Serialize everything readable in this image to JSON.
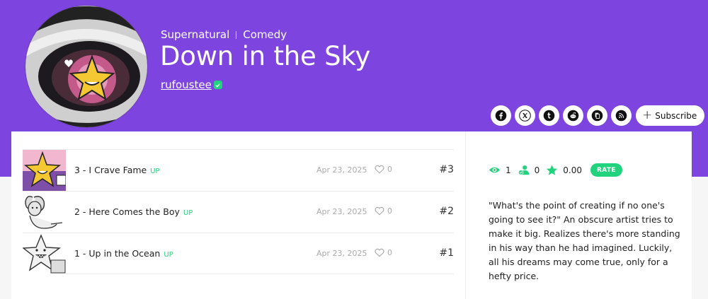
{
  "series": {
    "genres": [
      "Supernatural",
      "Comedy"
    ],
    "title": "Down in the Sky",
    "author": "rufoustee",
    "subscribe_label": "Subscribe"
  },
  "social": [
    {
      "name": "facebook-icon"
    },
    {
      "name": "x-icon"
    },
    {
      "name": "tumblr-icon"
    },
    {
      "name": "reddit-icon"
    },
    {
      "name": "copy-link-icon"
    },
    {
      "name": "rss-icon"
    }
  ],
  "episodes": [
    {
      "title": "3 - I Crave Fame",
      "badge": "UP",
      "date": "Apr 23, 2025",
      "likes": "0",
      "number": "#3"
    },
    {
      "title": "2 - Here Comes the Boy",
      "badge": "UP",
      "date": "Apr 23, 2025",
      "likes": "0",
      "number": "#2"
    },
    {
      "title": "1 - Up in the Ocean",
      "badge": "UP",
      "date": "Apr 23, 2025",
      "likes": "0",
      "number": "#1"
    }
  ],
  "stats": {
    "views": "1",
    "subscribers": "0",
    "rating": "0.00",
    "rate_label": "RATE"
  },
  "description": "\"What's the point of creating if no one's going to see it?\" An obscure artist tries to make it big. Realizes there's more standing in his way than he had imagined. Luckily, all his dreams may come true, only for a hefty price.",
  "colors": {
    "header": "#7e44e0",
    "accent_green": "#21d37d"
  }
}
